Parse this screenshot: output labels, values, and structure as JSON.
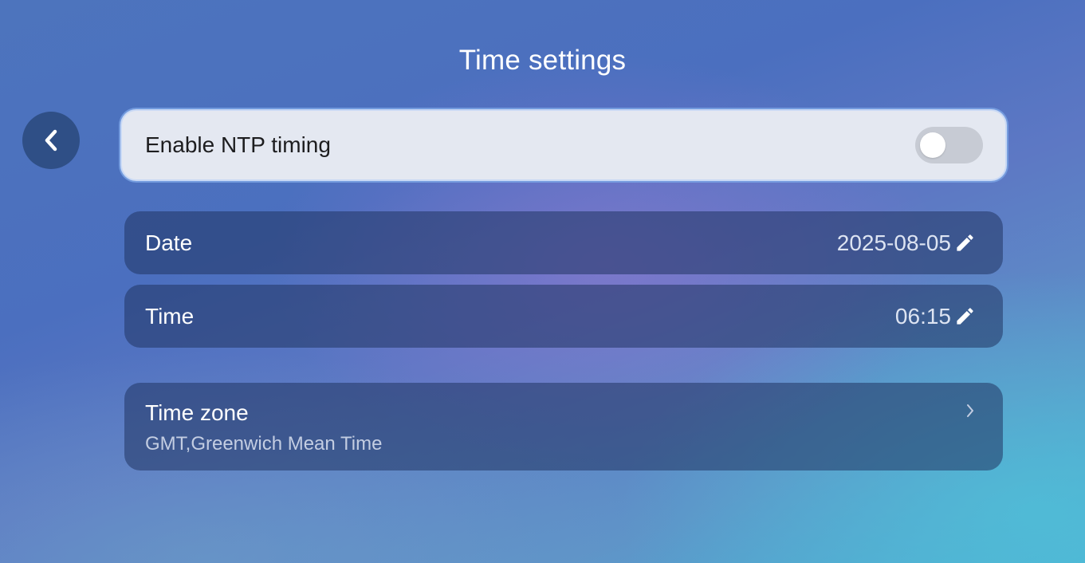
{
  "header": {
    "title": "Time settings"
  },
  "back_button": {
    "icon": "chevron-left-icon"
  },
  "ntp": {
    "label": "Enable NTP timing",
    "enabled": false
  },
  "date": {
    "label": "Date",
    "value": "2025-08-05",
    "icon": "pencil-icon"
  },
  "time": {
    "label": "Time",
    "value": "06:15",
    "icon": "pencil-icon"
  },
  "time_zone": {
    "label": "Time zone",
    "value": "GMT,Greenwich Mean Time",
    "icon": "chevron-right-icon"
  },
  "colors": {
    "back_button_bg": "#2f4f86",
    "ntp_row_bg": "#e4e8f1",
    "toggle_off_bg": "#c7cbd4",
    "card_bg": "rgba(32, 52, 98, 0.55)"
  }
}
